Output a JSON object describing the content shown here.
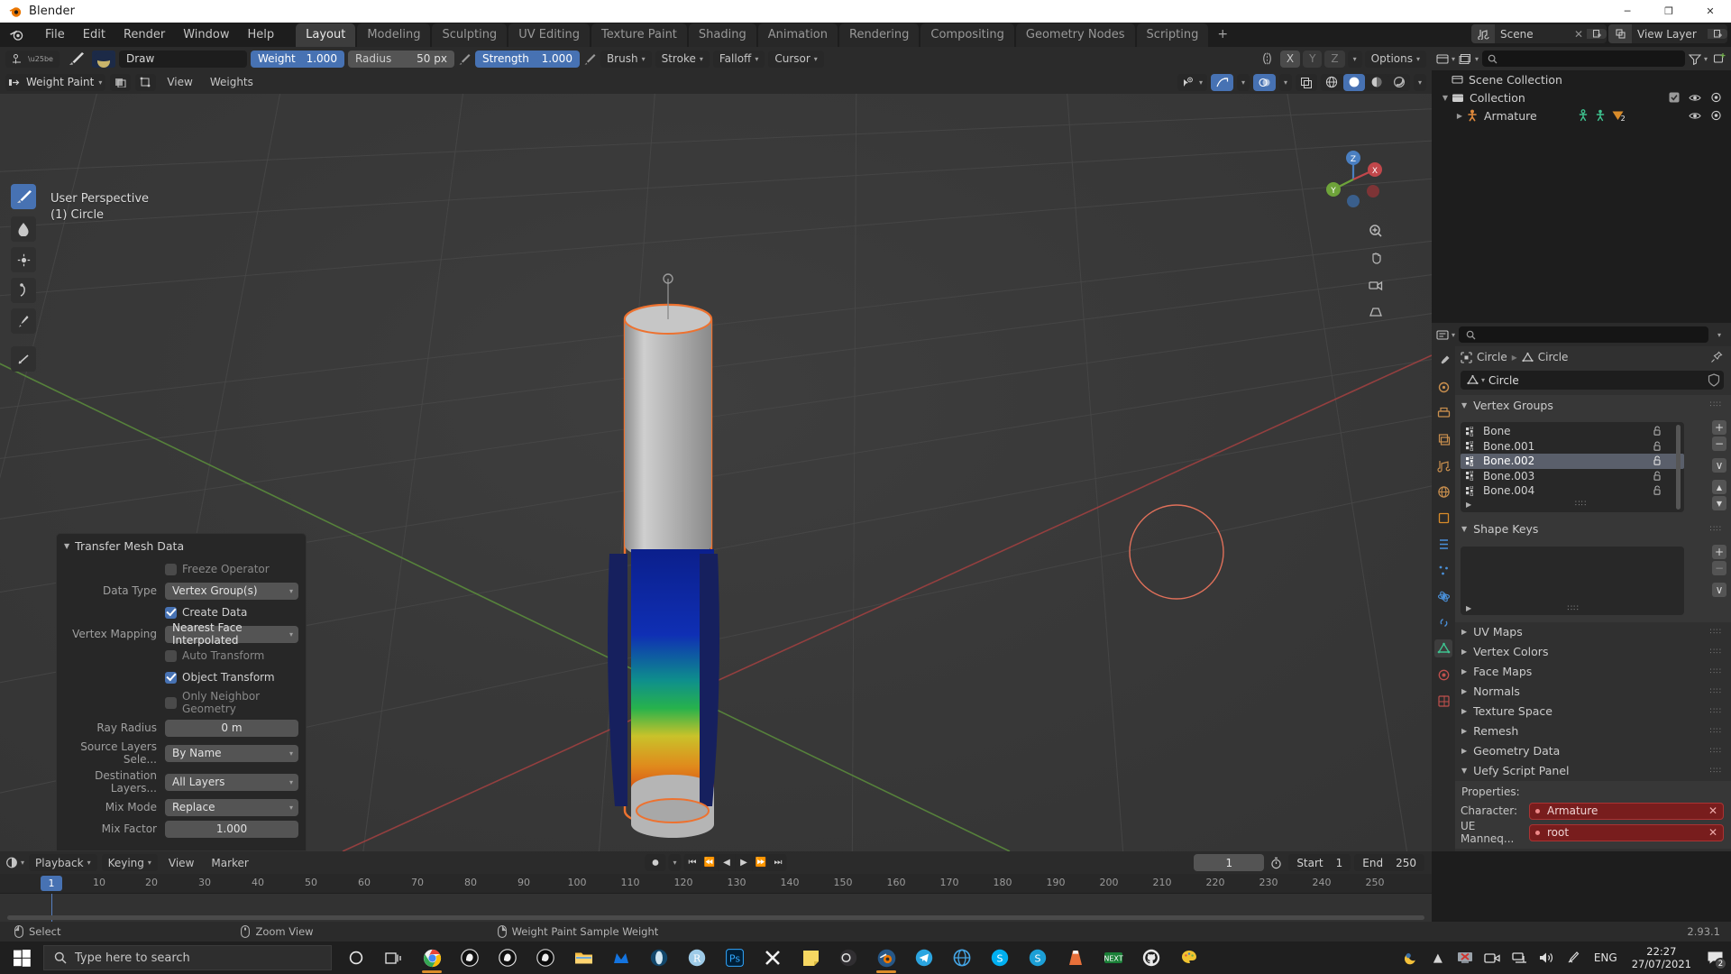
{
  "window": {
    "title": "Blender",
    "minimize": "─",
    "maximize": "❐",
    "close": "✕"
  },
  "topbar": {
    "menus": [
      "File",
      "Edit",
      "Render",
      "Window",
      "Help"
    ],
    "workspaces": [
      {
        "label": "Layout",
        "active": true
      },
      {
        "label": "Modeling",
        "active": false
      },
      {
        "label": "Sculpting",
        "active": false
      },
      {
        "label": "UV Editing",
        "active": false
      },
      {
        "label": "Texture Paint",
        "active": false
      },
      {
        "label": "Shading",
        "active": false
      },
      {
        "label": "Animation",
        "active": false
      },
      {
        "label": "Rendering",
        "active": false
      },
      {
        "label": "Compositing",
        "active": false
      },
      {
        "label": "Geometry Nodes",
        "active": false
      },
      {
        "label": "Scripting",
        "active": false
      }
    ],
    "add_workspace": "+",
    "scene_name": "Scene",
    "view_layer_name": "View Layer",
    "scene_x": "✕"
  },
  "viewport_header": {
    "brush_name": "Draw",
    "weight_label": "Weight",
    "weight_value": "1.000",
    "radius_label": "Radius",
    "radius_value": "50 px",
    "strength_label": "Strength",
    "strength_value": "1.000",
    "menus": [
      "Brush",
      "Stroke",
      "Falloff",
      "Cursor"
    ],
    "symmetry_axes": [
      "X",
      "Y",
      "Z"
    ],
    "options_label": "Options",
    "mode": "Weight Paint",
    "view_menus": [
      "View",
      "Weights"
    ]
  },
  "viewport": {
    "perspective": "User Perspective",
    "active_object": "(1) Circle",
    "gizmo_axes": [
      "X",
      "Y",
      "Z"
    ]
  },
  "operator_panel": {
    "title": "Transfer Mesh Data",
    "rows": [
      {
        "kind": "check",
        "label": "Freeze Operator",
        "checked": false,
        "dim": true
      },
      {
        "kind": "dropdown",
        "label": "Data Type",
        "value": "Vertex Group(s)"
      },
      {
        "kind": "check",
        "label": "Create Data",
        "checked": true,
        "dim": false
      },
      {
        "kind": "dropdown",
        "label": "Vertex Mapping",
        "value": "Nearest Face Interpolated"
      },
      {
        "kind": "check",
        "label": "Auto Transform",
        "checked": false,
        "dim": true
      },
      {
        "kind": "check",
        "label": "Object Transform",
        "checked": true,
        "dim": false
      },
      {
        "kind": "check",
        "label": "Only Neighbor Geometry",
        "checked": false,
        "dim": true
      },
      {
        "kind": "number",
        "label": "Ray Radius",
        "value": "0 m"
      },
      {
        "kind": "dropdown",
        "label": "Source Layers Sele...",
        "value": "By Name"
      },
      {
        "kind": "dropdown",
        "label": "Destination Layers...",
        "value": "All Layers"
      },
      {
        "kind": "dropdown",
        "label": "Mix Mode",
        "value": "Replace"
      },
      {
        "kind": "number",
        "label": "Mix Factor",
        "value": "1.000"
      }
    ]
  },
  "outliner": {
    "search_placeholder": "",
    "rows": [
      {
        "label": "Scene Collection",
        "indent": 0,
        "twisty": "",
        "icon": "collection-icon",
        "eye": false,
        "camera": false,
        "check": false
      },
      {
        "label": "Collection",
        "indent": 1,
        "twisty": "▼",
        "icon": "collection-icon",
        "eye": true,
        "camera": true,
        "check": true
      },
      {
        "label": "Armature",
        "indent": 2,
        "twisty": "▶",
        "icon": "armature-icon",
        "eye": true,
        "camera": true,
        "check": false,
        "badge": "2"
      }
    ]
  },
  "properties": {
    "search_placeholder": "",
    "breadcrumb": [
      "Circle",
      "Circle"
    ],
    "id_name": "Circle",
    "sections": [
      {
        "label": "Vertex Groups",
        "open": true
      },
      {
        "label": "Shape Keys",
        "open": true
      },
      {
        "label": "UV Maps",
        "open": false
      },
      {
        "label": "Vertex Colors",
        "open": false
      },
      {
        "label": "Face Maps",
        "open": false
      },
      {
        "label": "Normals",
        "open": false
      },
      {
        "label": "Texture Space",
        "open": false
      },
      {
        "label": "Remesh",
        "open": false
      },
      {
        "label": "Geometry Data",
        "open": false
      },
      {
        "label": "Uefy Script Panel",
        "open": true
      }
    ],
    "vertex_groups": [
      {
        "name": "Bone",
        "selected": false
      },
      {
        "name": "Bone.001",
        "selected": false
      },
      {
        "name": "Bone.002",
        "selected": true
      },
      {
        "name": "Bone.003",
        "selected": false
      },
      {
        "name": "Bone.004",
        "selected": false
      }
    ],
    "vg_buttons": [
      "+",
      "−",
      "∨",
      "▲",
      "▼"
    ],
    "shapekey_buttons": [
      "+",
      "−",
      "∨"
    ],
    "uefy": {
      "properties_label": "Properties:",
      "rows": [
        {
          "label": "Character:",
          "value": "Armature",
          "clear": "✕"
        },
        {
          "label": "UE Manneq...",
          "value": "root",
          "clear": "✕"
        }
      ]
    }
  },
  "timeline": {
    "menus": [
      "Playback",
      "Keying",
      "View",
      "Marker"
    ],
    "transport": [
      "⏮",
      "⏪",
      "◀",
      "▶",
      "⏩",
      "⏭"
    ],
    "current_frame": "1",
    "start_label": "Start",
    "start_value": "1",
    "end_label": "End",
    "end_value": "250",
    "ticks": [
      10,
      20,
      30,
      40,
      50,
      60,
      70,
      80,
      90,
      100,
      110,
      120,
      130,
      140,
      150,
      160,
      170,
      180,
      190,
      200,
      210,
      220,
      230,
      240,
      250
    ],
    "playhead_frame": "1"
  },
  "statusbar": {
    "items": [
      {
        "icon": "mouse-left-icon",
        "label": "Select"
      },
      {
        "icon": "mouse-middle-icon",
        "label": "Zoom View"
      },
      {
        "icon": "mouse-right-icon",
        "label": "Weight Paint Sample Weight"
      }
    ],
    "version": "2.93.1"
  },
  "taskbar": {
    "search_placeholder": "Type here to search",
    "apps": [
      "cortana-icon",
      "task-view-icon",
      "chrome-icon",
      "unreal-engine-icon",
      "unreal-engine-icon",
      "unreal-engine-icon",
      "file-explorer-icon",
      "malwarebytes-icon",
      "opera-icon",
      "r-icon",
      "photoshop-icon",
      "xsplit-icon",
      "sticky-notes-icon",
      "obs-icon",
      "blender-icon",
      "telegram-icon",
      "internet-icon",
      "skype-icon",
      "sublime-icon",
      "vlc-icon",
      "nextcloud-icon",
      "github-icon",
      "paint-icon"
    ],
    "language": "ENG",
    "time": "22:27",
    "date": "27/07/2021",
    "notification_count": "2"
  },
  "colors": {
    "accent_blue": "#4772b3",
    "selection_orange": "#ed7230",
    "panel_bg": "#303030",
    "editor_bg": "#1d1d1d",
    "uefy_red": "#781d1d"
  }
}
